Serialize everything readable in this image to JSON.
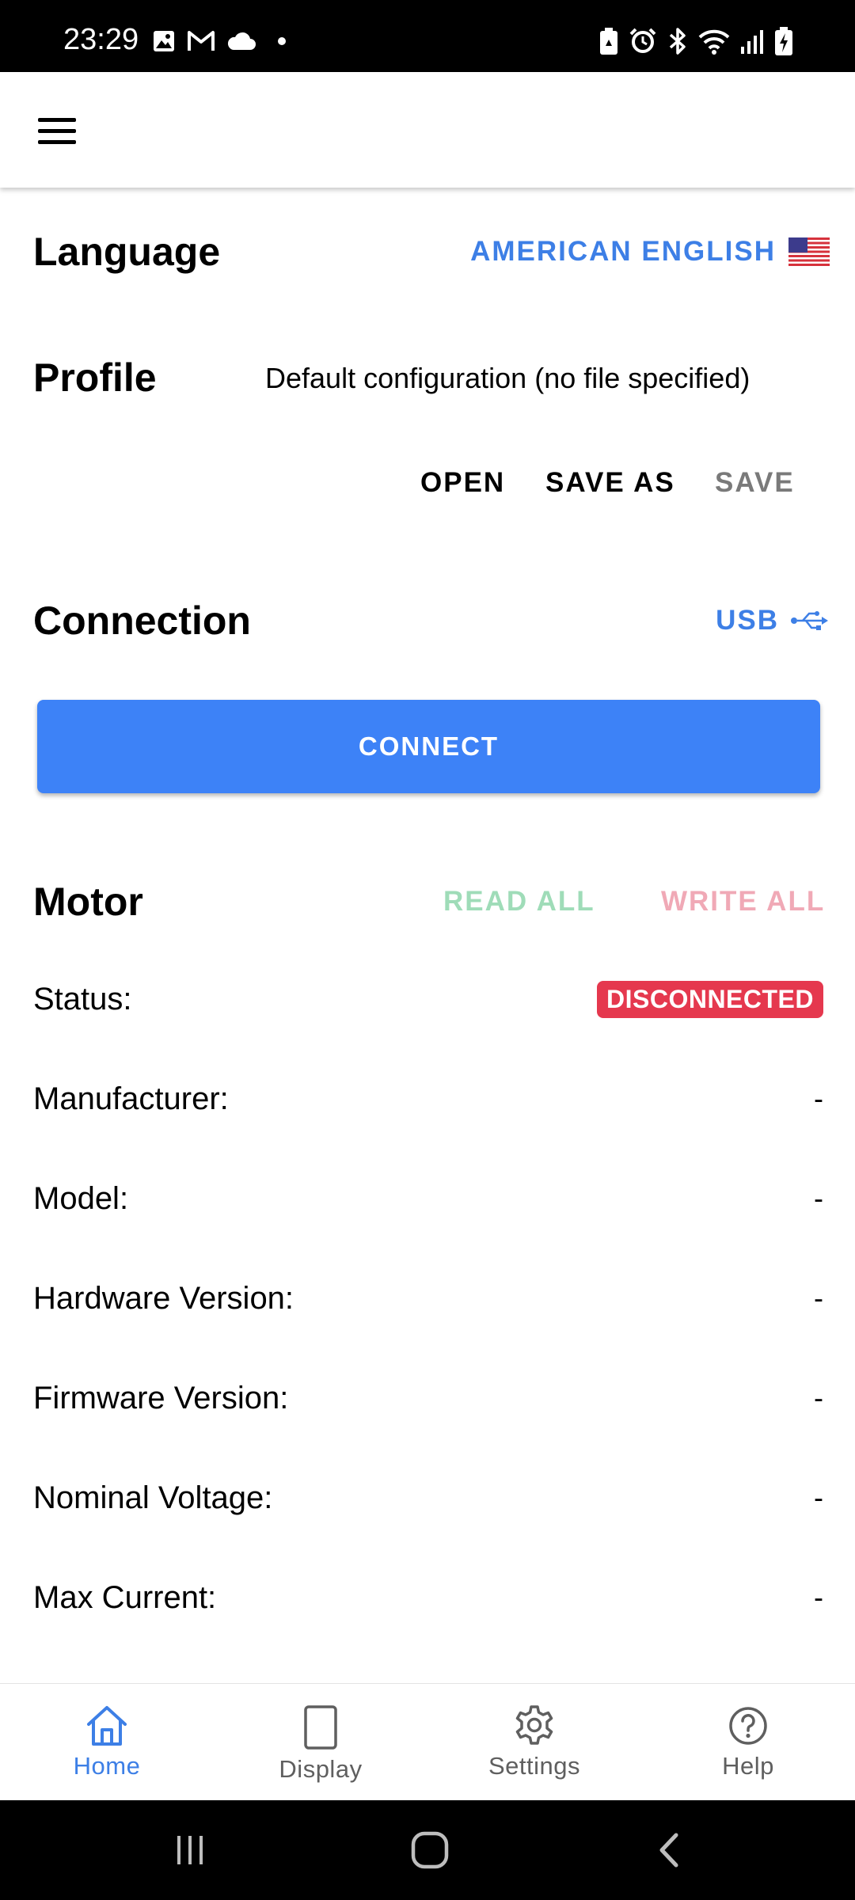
{
  "status_bar": {
    "time": "23:29",
    "left_icons": [
      "gallery-icon",
      "gmail-icon",
      "cloud-icon",
      "dot-icon"
    ],
    "right_icons": [
      "battery-saver-icon",
      "alarm-icon",
      "bluetooth-icon",
      "wifi-icon",
      "signal-icon",
      "battery-charging-icon"
    ]
  },
  "app_bar": {
    "menu_icon": "hamburger-menu-icon"
  },
  "language": {
    "title": "Language",
    "selected": "AMERICAN ENGLISH",
    "flag_icon": "us-flag-icon"
  },
  "profile": {
    "title": "Profile",
    "value": "Default configuration (no file specified)",
    "open_label": "OPEN",
    "save_as_label": "SAVE AS",
    "save_label": "SAVE"
  },
  "connection": {
    "title": "Connection",
    "type": "USB",
    "type_icon": "usb-icon",
    "connect_label": "CONNECT"
  },
  "motor": {
    "title": "Motor",
    "read_all_label": "READ ALL",
    "write_all_label": "WRITE ALL",
    "rows": [
      {
        "label": "Status:",
        "value": "DISCONNECTED"
      },
      {
        "label": "Manufacturer:",
        "value": "-"
      },
      {
        "label": "Model:",
        "value": "-"
      },
      {
        "label": "Hardware Version:",
        "value": "-"
      },
      {
        "label": "Firmware Version:",
        "value": "-"
      },
      {
        "label": "Nominal Voltage:",
        "value": "-"
      },
      {
        "label": "Max Current:",
        "value": "-"
      }
    ]
  },
  "bottom_nav": {
    "items": [
      {
        "label": "Home",
        "icon": "home-icon",
        "active": true
      },
      {
        "label": "Display",
        "icon": "display-icon",
        "active": false
      },
      {
        "label": "Settings",
        "icon": "gear-icon",
        "active": false
      },
      {
        "label": "Help",
        "icon": "help-icon",
        "active": false
      }
    ]
  },
  "colors": {
    "accent": "#3d7fe6",
    "connect_button": "#3d82f7",
    "disabled_text": "#7a7a7a",
    "read_all": "#9fdcb8",
    "write_all": "#f0a9b6",
    "badge_disconnected": "#e5384e"
  },
  "system_nav": {
    "recents_icon": "recents-icon",
    "home_icon": "system-home-icon",
    "back_icon": "back-icon"
  }
}
